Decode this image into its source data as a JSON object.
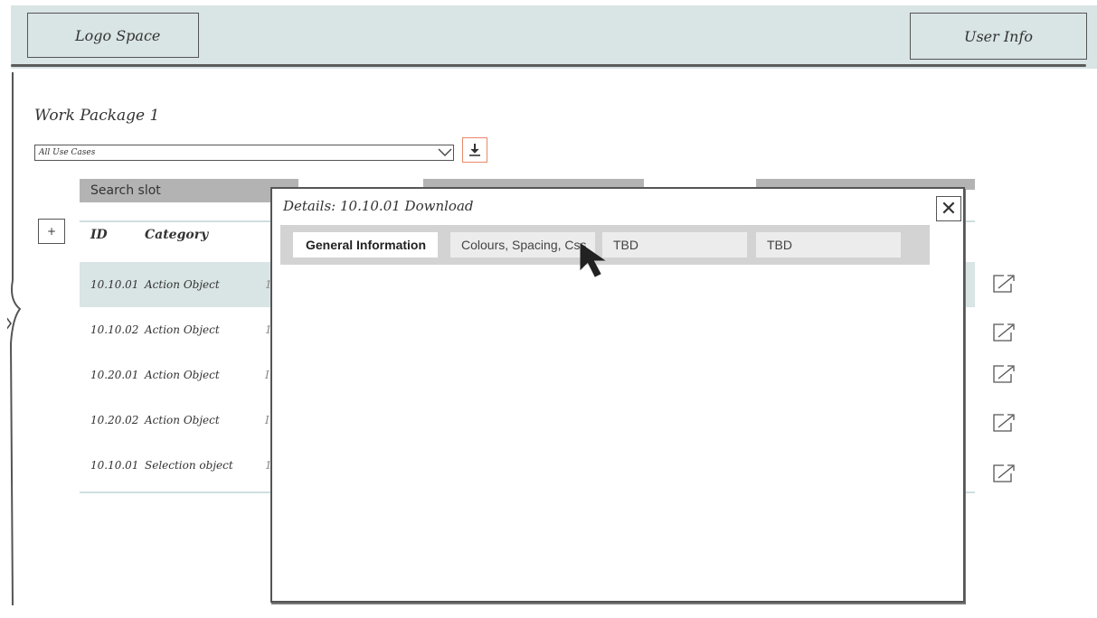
{
  "header": {
    "logo": "Logo Space",
    "user": "User Info"
  },
  "page": {
    "title": "Work Package 1"
  },
  "filter": {
    "value": "All Use Cases"
  },
  "toolbar": {
    "add_label": "+",
    "search_label": "Search slot"
  },
  "table": {
    "headers": {
      "id": "ID",
      "category": "Category"
    },
    "rows": [
      {
        "id": "10.10.01",
        "category": "Action Object",
        "x": "1"
      },
      {
        "id": "10.10.02",
        "category": "Action Object",
        "x": "1"
      },
      {
        "id": "10.20.01",
        "category": "Action Object",
        "x": "I"
      },
      {
        "id": "10.20.02",
        "category": "Action Object",
        "x": "I"
      },
      {
        "id": "10.10.01",
        "category": "Selection object",
        "x": "1"
      }
    ]
  },
  "modal": {
    "title": "Details: 10.10.01 Download",
    "close_glyph": "✕",
    "tabs": [
      "General Information",
      "Colours, Spacing, Css",
      "TBD",
      "TBD"
    ],
    "active_tab": 0
  },
  "icons": {
    "download": "download-icon",
    "share": "share-arrow-icon",
    "expand": "chevron-right-icon",
    "dropdown": "chevron-down-icon",
    "cursor": "mouse-pointer-icon"
  },
  "colors": {
    "accent": "#e8896b",
    "header_bg": "#d9e4e4",
    "row_selected": "#d9e4e4"
  }
}
